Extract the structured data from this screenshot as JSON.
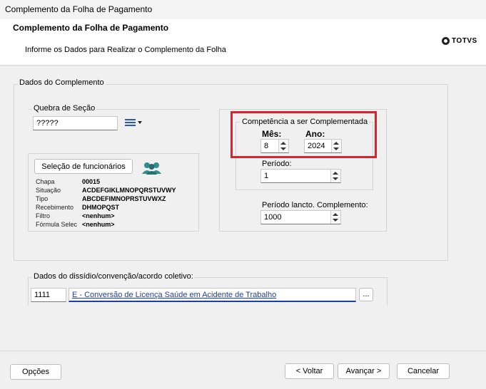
{
  "window": {
    "title": "Complemento da Folha de Pagamento"
  },
  "header": {
    "title": "Complemento da Folha de Pagamento",
    "subtitle": "Informe os Dados para Realizar o Complemento da Folha",
    "logo_text": "TOTVS"
  },
  "dados": {
    "legend": "Dados do Complemento",
    "quebra": {
      "label": "Quebra de Seção",
      "value": "?????"
    },
    "selecao_button": "Seleção de funcionários",
    "fields": [
      {
        "label": "Chapa",
        "value": "00015"
      },
      {
        "label": "Situação",
        "value": "ACDEFGIKLMNOPQRSTUVWY"
      },
      {
        "label": "Tipo",
        "value": "ABCDEFIMNOPRSTUVWXZ"
      },
      {
        "label": "Recebimento",
        "value": "DHMOPQST"
      },
      {
        "label": "Filtro",
        "value": "<nenhum>"
      },
      {
        "label": "Fórmula Selec",
        "value": "<nenhum>"
      }
    ],
    "competencia": {
      "legend": "Competência a ser Complementada",
      "mes_label": "Mês:",
      "mes_value": "8",
      "ano_label": "Ano:",
      "ano_value": "2024"
    },
    "periodo": {
      "label": "Período:",
      "value": "1"
    },
    "periodo_lancto": {
      "label": "Período lancto. Complemento:",
      "value": "1000"
    },
    "dissidio": {
      "legend": "Dados do dissídio/convenção/acordo coletivo:",
      "code": "1111",
      "description": "E - Conversão de Licença Saúde em Acidente de Trabalho",
      "browse_label": "..."
    }
  },
  "footer": {
    "opcoes": "Opções",
    "voltar": "< Voltar",
    "avancar": "Avançar >",
    "cancelar": "Cancelar"
  },
  "colors": {
    "highlight": "#d9232e",
    "link": "#1a3fa6"
  }
}
